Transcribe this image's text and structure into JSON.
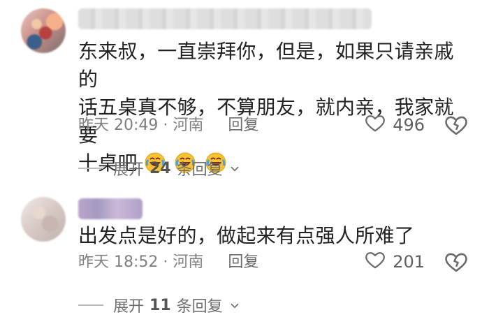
{
  "comments": [
    {
      "text_line1": "东来叔，一直崇拜你，但是，如果只请亲戚的",
      "text_line2": "话五桌真不够，不算朋友，就内亲，我家就要",
      "text_line3": "十桌吧",
      "emoji_icons": [
        "laughing-crying-emoji-icon",
        "laughing-crying-emoji-icon",
        "laughing-crying-emoji-icon"
      ],
      "time": "昨天 20:49",
      "location": "河南",
      "reply_label": "回复",
      "likes": "496",
      "expand": {
        "prefix": "展开",
        "count": "24",
        "suffix": "条回复"
      }
    },
    {
      "text_line1": "出发点是好的，做起来有点强人所难了",
      "time": "昨天 18:52",
      "location": "河南",
      "reply_label": "回复",
      "likes": "201",
      "expand": {
        "prefix": "展开",
        "count": "11",
        "suffix": "条回复"
      }
    }
  ],
  "colors": {
    "text": "#222222",
    "meta": "#7f7f7f",
    "icon": "#606060"
  }
}
